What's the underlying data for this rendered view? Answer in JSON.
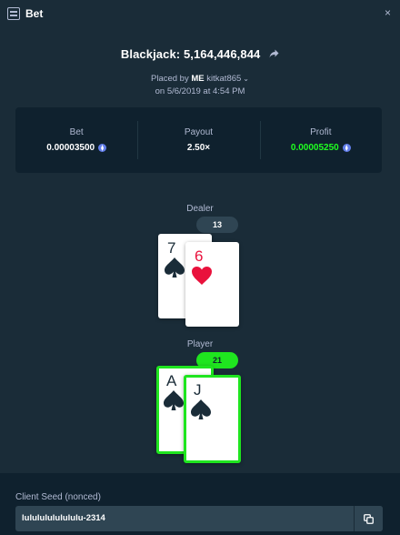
{
  "header": {
    "title": "Bet",
    "icon": "bet-slip-icon",
    "close_label": "×"
  },
  "game": {
    "title": "Blackjack: 5,164,446,844",
    "share_icon": "share-arrow-icon"
  },
  "placed": {
    "prefix": "Placed by",
    "me": "ME",
    "user": "kitkat865",
    "date": "on 5/6/2019 at 4:54 PM"
  },
  "stats": {
    "bet_label": "Bet",
    "bet_value": "0.00003500",
    "payout_label": "Payout",
    "payout_value": "2.50×",
    "profit_label": "Profit",
    "profit_value": "0.00005250",
    "currency_icon": "eth-coin-icon"
  },
  "dealer": {
    "label": "Dealer",
    "score": "13",
    "cards": [
      {
        "rank": "7",
        "suit": "spades",
        "color": "black"
      },
      {
        "rank": "6",
        "suit": "hearts",
        "color": "red"
      }
    ]
  },
  "player": {
    "label": "Player",
    "score": "21",
    "cards": [
      {
        "rank": "A",
        "suit": "spades",
        "color": "black"
      },
      {
        "rank": "J",
        "suit": "spades",
        "color": "black"
      }
    ]
  },
  "seed": {
    "label": "Client Seed (nonced)",
    "value": "lulululululululu-2314",
    "copy_icon": "copy-icon"
  },
  "colors": {
    "background": "#1a2c38",
    "panel": "#0f212e",
    "muted": "#b1bad3",
    "win_green": "#1fe51f",
    "profit_green": "#1fff20",
    "heart_red": "#e9113c"
  }
}
